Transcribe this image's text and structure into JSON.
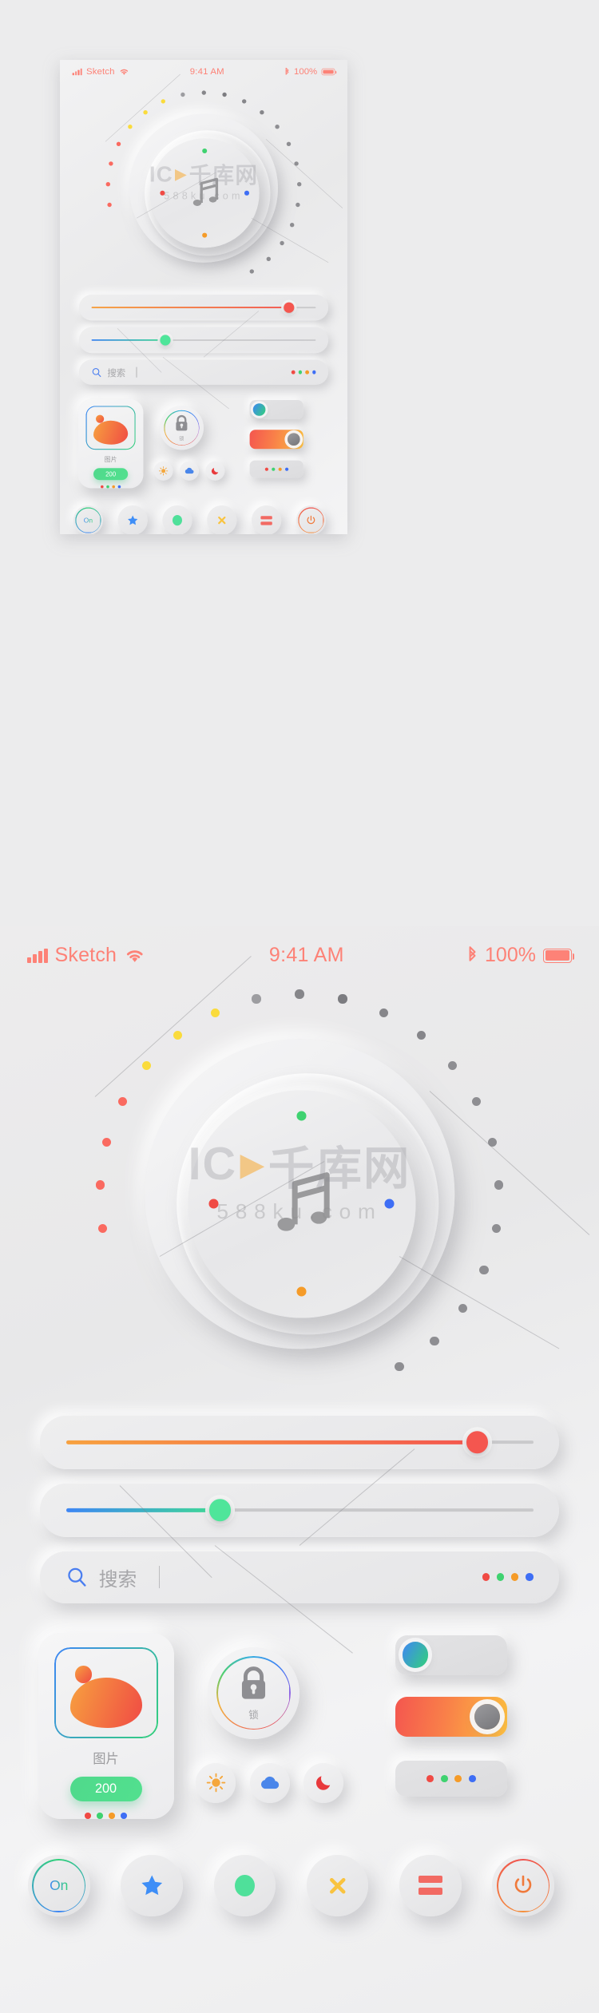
{
  "meta": {
    "bg_color": "#ececed",
    "accent_coral": "#fd8277"
  },
  "watermark": {
    "main": "千库网",
    "sub": "588ku.com",
    "play_icon": "play-triangle-icon"
  },
  "status_bar": {
    "carrier": "Sketch",
    "time": "9:41 AM",
    "battery_percent": "100%",
    "icons": [
      "signal-bars-icon",
      "wifi-icon",
      "bluetooth-icon",
      "battery-icon"
    ]
  },
  "knob": {
    "icon": "music-note-icon",
    "inner_dots": [
      {
        "name": "knob-dot-top",
        "color": "#3fd270",
        "angle": 270
      },
      {
        "name": "knob-dot-left",
        "color": "#f04a44",
        "angle": 180
      },
      {
        "name": "knob-dot-right",
        "color": "#3e6ef5",
        "angle": 0
      },
      {
        "name": "knob-dot-bottom",
        "color": "#f59b28",
        "angle": 90
      }
    ],
    "ring_dot_count": 21,
    "ring_colors": [
      "#fa6a60",
      "#fa6a60",
      "#fa6a60",
      "#fa6a60",
      "#fadb3c",
      "#fadb3c",
      "#fadb3c",
      "#9d9da1",
      "#86868a",
      "#7c7c80",
      "#86868a",
      "#86868a",
      "#8e8e92",
      "#8e8e92",
      "#8e8e92",
      "#8e8e92",
      "#8e8e92",
      "#8e8e92",
      "#8e8e92",
      "#8e8e92",
      "#8e8e92"
    ]
  },
  "sliders": [
    {
      "name": "volume-slider",
      "value": 88,
      "fill_gradient": [
        "#f7a13f",
        "#f4564f"
      ],
      "thumb_color": "#f4564f",
      "track_color": "#c9c9cb"
    },
    {
      "name": "brightness-slider",
      "value": 33,
      "fill_gradient": [
        "#3e86f5",
        "#3fdc92"
      ],
      "thumb_color": "#4fe59a",
      "track_color": "#c9c9cb"
    }
  ],
  "search": {
    "icon": "search-icon",
    "icon_color": "#4a7ef0",
    "placeholder": "搜索",
    "value": "",
    "dots": [
      "#f04a44",
      "#3fd270",
      "#f59b28",
      "#3e6ef5"
    ]
  },
  "card": {
    "image_label": "图片",
    "frame_gradient": [
      "#3e86f5",
      "#33d17a"
    ],
    "blob_gradient": [
      "#f7a13f",
      "#f04a44"
    ],
    "button_label": "200",
    "button_color": "#4fd98c",
    "dots": [
      "#f04a44",
      "#3fd270",
      "#f59b28",
      "#3e6ef5"
    ]
  },
  "lock": {
    "icon": "lock-icon",
    "label": "锁",
    "ring": "rainbow-gradient-ring"
  },
  "toggles": [
    {
      "name": "toggle-off",
      "state": "off",
      "thumb": "blue-green-gradient",
      "track_color": "#e0e0e2"
    },
    {
      "name": "toggle-on",
      "state": "on",
      "thumb": "gray",
      "track_gradient": [
        "#f4564f",
        "#fbbe3f"
      ]
    },
    {
      "name": "toggle-dots",
      "state": "dots",
      "dots": [
        "#f04a44",
        "#3fd270",
        "#f59b28",
        "#3e6ef5"
      ]
    }
  ],
  "weather_icons": [
    {
      "name": "sun-icon",
      "color": "#f5a73c",
      "label": "sun"
    },
    {
      "name": "cloud-icon",
      "color": "#4a86ea",
      "label": "cloud"
    },
    {
      "name": "moon-icon",
      "color": "#e8393c",
      "label": "moon"
    }
  ],
  "bottom_buttons": [
    {
      "name": "button-on",
      "type": "text",
      "label": "On",
      "ring": "bluegreen"
    },
    {
      "name": "button-favorite",
      "type": "icon",
      "icon": "star-icon",
      "color": "#3e8ef7"
    },
    {
      "name": "button-record",
      "type": "icon",
      "icon": "circle-dot-icon",
      "color": "#4fe09a"
    },
    {
      "name": "button-close",
      "type": "icon",
      "icon": "close-x-icon",
      "color": "#f9c33f"
    },
    {
      "name": "button-menu",
      "type": "icon",
      "icon": "equals-menu-icon",
      "color": "#f26a63"
    },
    {
      "name": "button-power",
      "type": "icon",
      "icon": "power-icon",
      "color": "#f07a3c",
      "ring": "orange"
    }
  ]
}
